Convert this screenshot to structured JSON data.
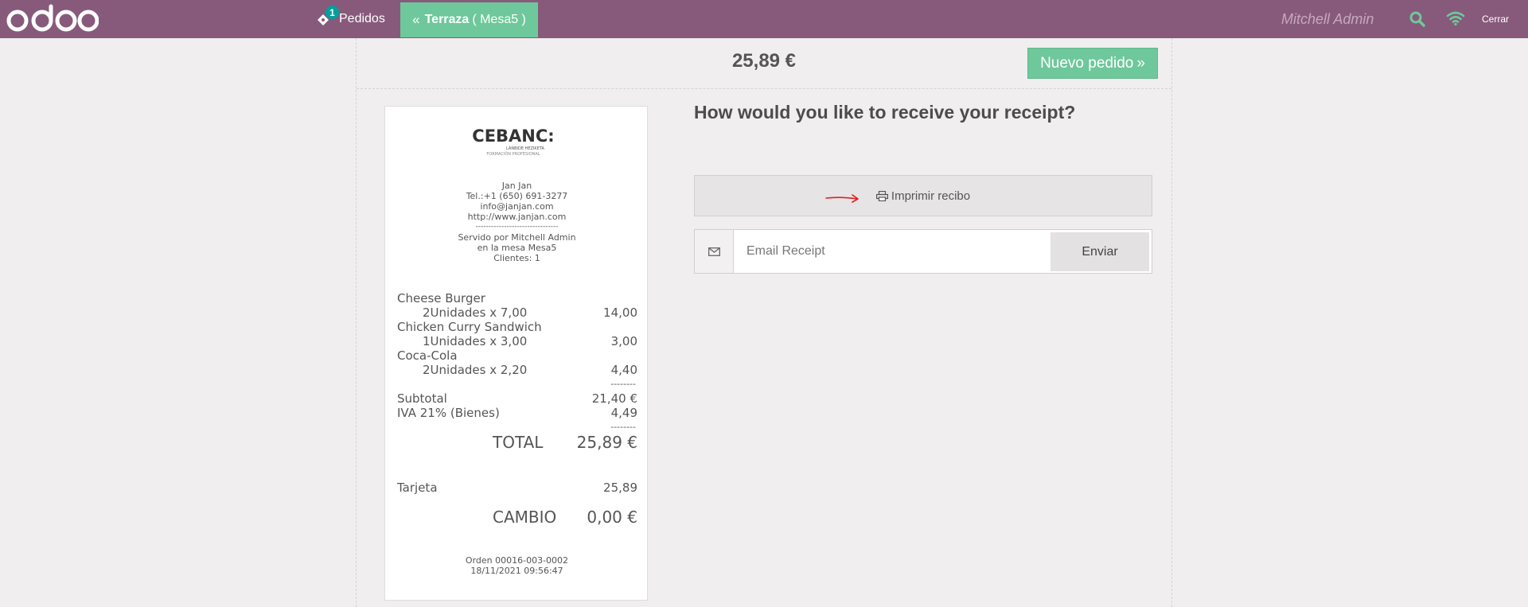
{
  "navbar": {
    "logo_text": "odoo",
    "orders_badge": "1",
    "orders_label": "Pedidos",
    "table_floor": "Terraza",
    "table_name": "( Mesa5 )",
    "user_name": "Mitchell Admin",
    "close_label": "Cerrar",
    "icons": [
      "chevron-double-left-icon",
      "search-icon",
      "wifi-icon",
      "ticket-icon"
    ],
    "colors": {
      "bar": "#875a7b",
      "accent": "#6ec89b",
      "badge": "#00a09d",
      "status_green": "#6ec89b"
    }
  },
  "header": {
    "total": "25,89 €",
    "new_order_label": "Nuevo pedido"
  },
  "receipt": {
    "logo_text": "CEBANC",
    "logo_sub1": "LANBIDE HEZIKETA",
    "logo_sub2": "FORMACIÓN PROFESIONAL",
    "company": "Jan Jan",
    "phone": "Tel.:+1 (650) 691-3277",
    "email": "info@janjan.com",
    "website": "http://www.janjan.com",
    "separator": "--------------------------------",
    "served_by": "Servido por Mitchell Admin",
    "table": "en la mesa Mesa5",
    "clients": "Clientes: 1",
    "lines": [
      {
        "name": "Cheese Burger",
        "qty": "2Unidades x 7,00",
        "price": "14,00"
      },
      {
        "name": "Chicken Curry Sandwich",
        "qty": "1Unidades x 3,00",
        "price": "3,00"
      },
      {
        "name": "Coca-Cola",
        "qty": "2Unidades x 2,20",
        "price": "4,40"
      }
    ],
    "dash": "--------",
    "subtotal_label": "Subtotal",
    "subtotal_value": "21,40 €",
    "tax_label": "IVA 21% (Bienes)",
    "tax_value": "4,49",
    "total_label": "TOTAL",
    "total_value": "25,89 €",
    "payment_label": "Tarjeta",
    "payment_value": "25,89",
    "change_label": "CAMBIO",
    "change_value": "0,00 €",
    "order_ref": "Orden 00016-003-0002",
    "order_date": "18/11/2021 09:56:47"
  },
  "actions": {
    "question": "How would you like to receive your receipt?",
    "print_label": "Imprimir recibo",
    "email_placeholder": "Email Receipt",
    "send_label": "Enviar",
    "annotation_color": "#e02020"
  }
}
